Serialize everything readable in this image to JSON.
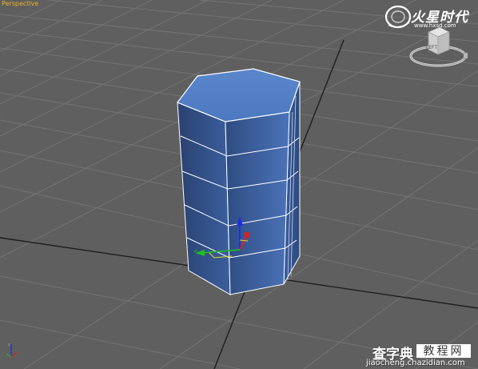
{
  "viewport": {
    "label": "Perspective",
    "label_color": "#f0b020",
    "background_color": "#5f5f5f",
    "grid_color": "#737373",
    "grid_axis_color": "#1e1e1e"
  },
  "object": {
    "type": "hexagonal-prism",
    "face_color": "#4a73b8",
    "edge_color": "#ffffff",
    "height_segments": 5
  },
  "gizmo": {
    "icon": "transform-gizmo-icon",
    "x_axis_color": "#d82020",
    "y_axis_color": "#20c020",
    "z_axis_color": "#2030e0"
  },
  "viewcube": {
    "icon": "viewcube-icon",
    "face_label": "LEFT"
  },
  "brand": {
    "icon": "brand-logo-icon",
    "name": "火星时代",
    "url": "www.hxsd.com"
  },
  "watermark": {
    "title": "查字典",
    "subtitle": "教程网",
    "url": "jiaocheng.chazidian.com"
  },
  "world_axis": {
    "icon": "world-axis-icon"
  }
}
